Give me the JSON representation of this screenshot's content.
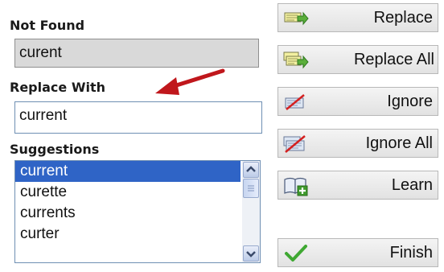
{
  "not_found": {
    "label": "Not Found",
    "value": "curent"
  },
  "replace_with": {
    "label": "Replace With",
    "value": "current"
  },
  "suggestions": {
    "label": "Suggestions",
    "items": [
      "current",
      "curette",
      "currents",
      "curter"
    ],
    "selected_index": 0
  },
  "buttons": {
    "replace": "Replace",
    "replace_all": "Replace All",
    "ignore": "Ignore",
    "ignore_all": "Ignore All",
    "learn": "Learn",
    "finish": "Finish"
  },
  "colors": {
    "selection": "#2f64c6",
    "annotation_arrow": "#c0171c",
    "finish_check": "#3fa832"
  },
  "icons": {
    "replace": "replace-icon",
    "replace_all": "replace-all-icon",
    "ignore": "ignore-icon",
    "ignore_all": "ignore-all-icon",
    "learn": "learn-book-icon",
    "finish": "checkmark-icon"
  }
}
